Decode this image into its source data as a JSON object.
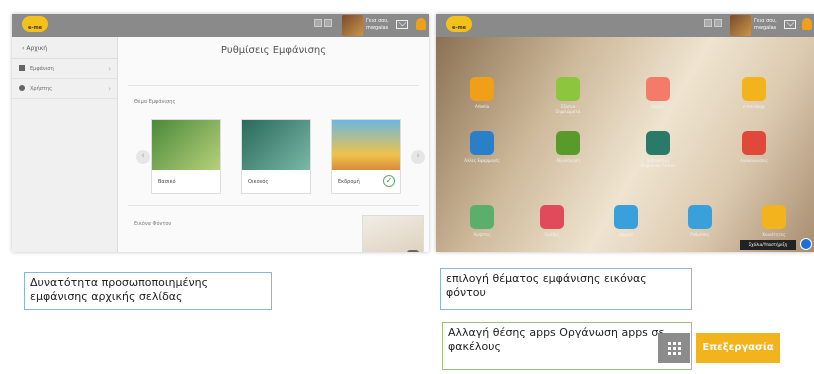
{
  "left_screenshot": {
    "topbar": {
      "user_text": "Γεια σου, mwgalas",
      "logo_text": "e-me"
    },
    "sidebar": {
      "back_label": "Αρχική",
      "items": [
        {
          "label": "Εμφάνιση",
          "icon": "paint-roller-icon"
        },
        {
          "label": "Χρήστης",
          "icon": "user-gear-icon"
        }
      ]
    },
    "main": {
      "title": "Ρυθμίσεις Εμφάνισης",
      "theme_section_label": "Θέμα Εμφάνισης",
      "themes": [
        {
          "name": "Βασικό",
          "selected": false
        },
        {
          "name": "Οικονός",
          "selected": false
        },
        {
          "name": "Εκδρομή",
          "selected": true
        }
      ],
      "background_section_label": "Εικόνα Φόντου"
    }
  },
  "right_screenshot": {
    "topbar": {
      "user_text": "Γεια σου, mwgalas",
      "logo_text": "e-me"
    },
    "apps": [
      {
        "label": "Arbelia",
        "color": "#f0a018"
      },
      {
        "label": "Έξυπνα Σημειώματα",
        "color": "#8cc63f"
      },
      {
        "label": "Αρχείο",
        "color": "#f47a6a"
      },
      {
        "label": "e-me blogs",
        "color": "#f2b31c"
      },
      {
        "label": "Άλλες Εφαρμογές",
        "color": "#2a7fc9"
      },
      {
        "label": "Αξιολόγηση",
        "color": "#5a9a2a"
      },
      {
        "label": "Βιβλιοθήκη Ψηφιακού Υλικού",
        "color": "#2a7a6a"
      },
      {
        "label": "Ανακοινώσεις",
        "color": "#e0483a"
      },
      {
        "label": "Χρήστες",
        "color": "#5ab06a"
      },
      {
        "label": "Ομάδες",
        "color": "#e04a5a"
      },
      {
        "label": "Αρχεία",
        "color": "#3aa0dc"
      },
      {
        "label": "Ρυθμίσεις",
        "color": "#3aa0dc"
      },
      {
        "label": "Κοινότητες",
        "color": "#f2b31c"
      }
    ],
    "edit_badge": "Σχόλια/Υποστήριξη"
  },
  "notes": {
    "personalization": "Δυνατότητα προσωποποιημένης εμφάνισης αρχικής σελίδας",
    "background_theme": "επιλογή θέματος εμφάνισης εικόνας φόντου",
    "apps_move": "Αλλαγή θέσης apps Οργάνωση apps σε φακέλους"
  },
  "edit_button": {
    "label": "Επεξεργασία"
  }
}
